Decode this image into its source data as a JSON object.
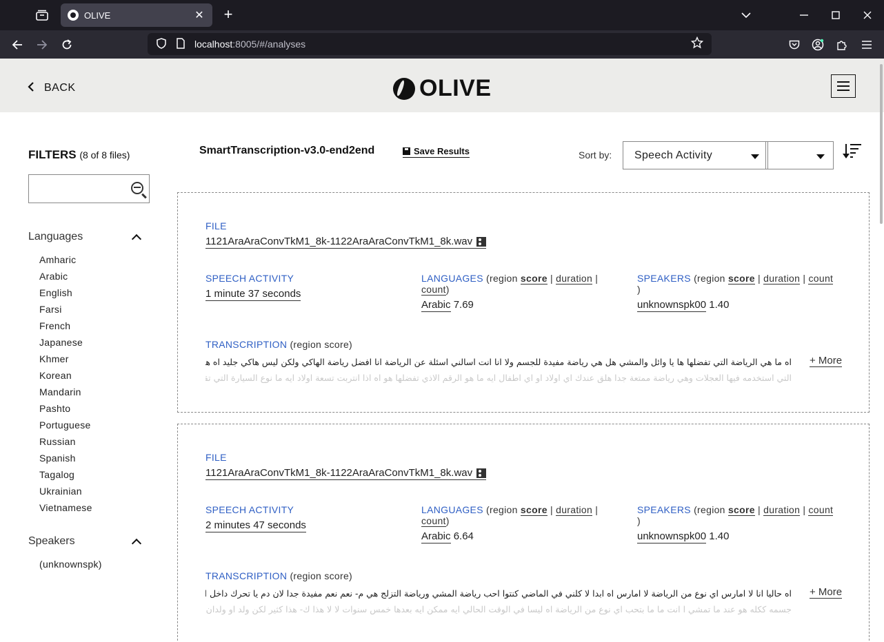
{
  "browser": {
    "tab_title": "OLIVE",
    "url_host": "localhost",
    "url_rest": ":8005/#/analyses"
  },
  "header": {
    "back_label": "BACK",
    "logo_text": "OLIVE"
  },
  "sidebar": {
    "filters_title": "FILTERS",
    "filters_count": "(8 of 8 files)",
    "search_value": "",
    "languages_title": "Languages",
    "languages": [
      "Amharic",
      "Arabic",
      "English",
      "Farsi",
      "French",
      "Japanese",
      "Khmer",
      "Korean",
      "Mandarin",
      "Pashto",
      "Portuguese",
      "Russian",
      "Spanish",
      "Tagalog",
      "Ukrainian",
      "Vietnamese"
    ],
    "speakers_title": "Speakers",
    "speakers": [
      "(unknownspk)"
    ]
  },
  "toolbar": {
    "analysis_name": "SmartTranscription-v3.0-end2end",
    "save_label": "Save Results",
    "sort_label": "Sort by:",
    "sort_value": "Speech Activity",
    "sort_secondary_value": ""
  },
  "cards": [
    {
      "file_label": "FILE",
      "file_name": "1121AraAraConvTkM1_8k-1122AraAraConvTkM1_8k.wav",
      "speech_label": "SPEECH ACTIVITY",
      "speech_value": "1 minute 37 seconds",
      "lang_label": "LANGUAGES",
      "lang_opts": {
        "open": "(region ",
        "score": "score",
        "sep1": " | ",
        "duration": "duration",
        "sep2": " | ",
        "count": "count",
        "close": ")"
      },
      "lang_name": "Arabic",
      "lang_score": "7.69",
      "spk_label": "SPEAKERS",
      "spk_opts": {
        "open": "(region ",
        "score": "score",
        "sep1": " | ",
        "duration": "duration",
        "sep2": " | ",
        "count": "count",
        "close": ")"
      },
      "spk_name": "unknownspk00",
      "spk_score": "1.40",
      "trans_label": "TRANSCRIPTION",
      "trans_paren": "(region score)",
      "trans_line1": "اه ما هي الرياضة التي تفضلها ها يا وائل والمشي هل هي رياضة مفيدة للجسم ولا انا انت اسالني اسئلة عن الرياضة انا افضل رياضة الهاكي ولكن ليس هاكي جليد اه هاك",
      "trans_line2": "التي استخدمه فيها العجلات وهي رياضة ممتعة جدا هلق عندك اي اولاد او اي اطفال ايه ما هو الرقم الاذي تفضلها هو اه اذا انتربت تسعة اولاد ايه ما نوع السيارة التي تقود",
      "more_label": "+ More"
    },
    {
      "file_label": "FILE",
      "file_name": "1121AraAraConvTkM1_8k-1122AraAraConvTkM1_8k.wav",
      "speech_label": "SPEECH ACTIVITY",
      "speech_value": "2 minutes 47 seconds",
      "lang_label": "LANGUAGES",
      "lang_opts": {
        "open": "(region ",
        "score": "score",
        "sep1": " | ",
        "duration": "duration",
        "sep2": " | ",
        "count": "count",
        "close": ")"
      },
      "lang_name": "Arabic",
      "lang_score": "6.64",
      "spk_label": "SPEAKERS",
      "spk_opts": {
        "open": "(region ",
        "score": "score",
        "sep1": " | ",
        "duration": "duration",
        "sep2": " | ",
        "count": "count",
        "close": ")"
      },
      "spk_name": "unknownspk00",
      "spk_score": "1.40",
      "trans_label": "TRANSCRIPTION",
      "trans_paren": "(region score)",
      "trans_line1": "اه حاليا انا لا امارس اي نوع من الرياضة لا امارس اه ابدا لا كلني في الماضي كنتوا احب رياضة المشي ورياضة التزلج هي م- نعم نعم مفيدة جدا لان دم يا تحرك داخل اه",
      "trans_line2": "جسمه ككله هو عند ما تمشي ا انت ما ما بتحب اي نوع من الرياضة اه ليسا في الوقت الحالي ايه ممكن ايه بعدها خمس سنوات لا لا هذا ك- هذا كثير لكن ولد او ولدان اثنان اه",
      "more_label": "+ More"
    }
  ]
}
